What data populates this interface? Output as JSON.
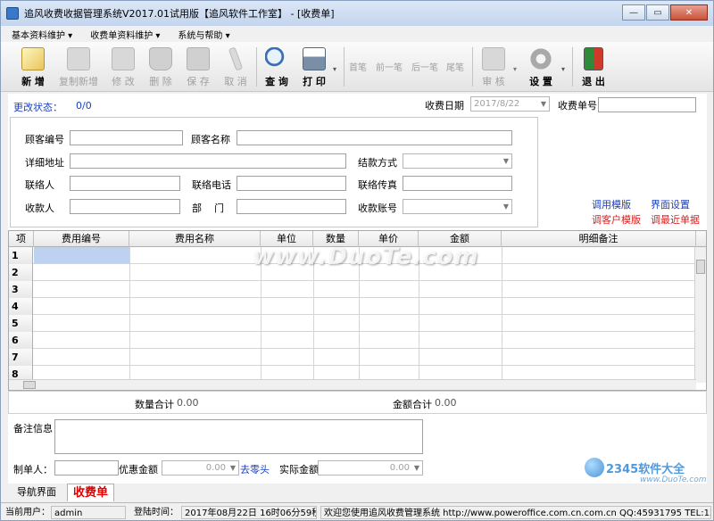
{
  "window": {
    "title": "追风收费收据管理系统V2017.01试用版【追风软件工作室】 - [收费单]",
    "controls": [
      "—",
      "▭",
      "✕"
    ]
  },
  "menu": [
    "基本资料维护 ▾",
    "收费单资料维护 ▾",
    "系统与帮助 ▾"
  ],
  "toolbar": {
    "new": "新 增",
    "copy_new": "复制新增",
    "edit": "修 改",
    "delete": "删 除",
    "save": "保 存",
    "cancel": "取 消",
    "query": "查 询",
    "print": "打 印",
    "first": "首笔",
    "prev": "前一笔",
    "next": "后一笔",
    "last": "尾笔",
    "audit": "审 核",
    "settings": "设 置",
    "exit": "退 出"
  },
  "status": {
    "label": "更改状态：",
    "value": "0/0"
  },
  "header_fields": {
    "date_label": "收费日期",
    "date_value": "2017/8/22",
    "doc_no_label": "收费单号"
  },
  "form": {
    "customer_code": "顾客编号",
    "customer_name": "顾客名称",
    "address": "详细地址",
    "payment_method": "结款方式",
    "contact": "联络人",
    "phone": "联络电话",
    "fax": "联络传真",
    "payee": "收款人",
    "department": "部    门",
    "account": "收款账号"
  },
  "links": {
    "use_template": "调用模版",
    "ui_settings": "界面设置",
    "customer_template": "调客户模版",
    "recent_doc": "调最近单据"
  },
  "grid": {
    "columns": [
      "项",
      "费用编号",
      "费用名称",
      "单位",
      "数量",
      "单价",
      "金额",
      "明细备注"
    ],
    "rows": [
      "1",
      "2",
      "3",
      "4",
      "5",
      "6",
      "7",
      "8"
    ]
  },
  "totals": {
    "qty_label": "数量合计",
    "qty_value": "0.00",
    "amount_label": "金额合计",
    "amount_value": "0.00"
  },
  "bottom": {
    "remark_label": "备注信息",
    "maker_label": "制单人：",
    "discount_label": "优惠金额",
    "discount_value": "0.00",
    "round_link": "去零头",
    "actual_label": "实际金额",
    "actual_value": "0.00"
  },
  "tabs": [
    "导航界面",
    "收费单"
  ],
  "statusbar": {
    "user_label": "当前用户：",
    "user": "admin",
    "login_label": "登陆时间：",
    "login_time": "2017年08月22日  16时06分59秒",
    "welcome": "欢迎您使用追风收费管理系统 http://www.poweroffice.com.cn.com.cn QQ:45931795 TEL:15"
  },
  "watermarks": {
    "duote": "www.DuoTe.com",
    "brand": "2345软件大全",
    "brand_url": "www.DuoTe.com"
  },
  "colors": {
    "link_blue": "#1a3fc4",
    "link_red": "#d81e1e",
    "tab_red": "#e00000"
  }
}
